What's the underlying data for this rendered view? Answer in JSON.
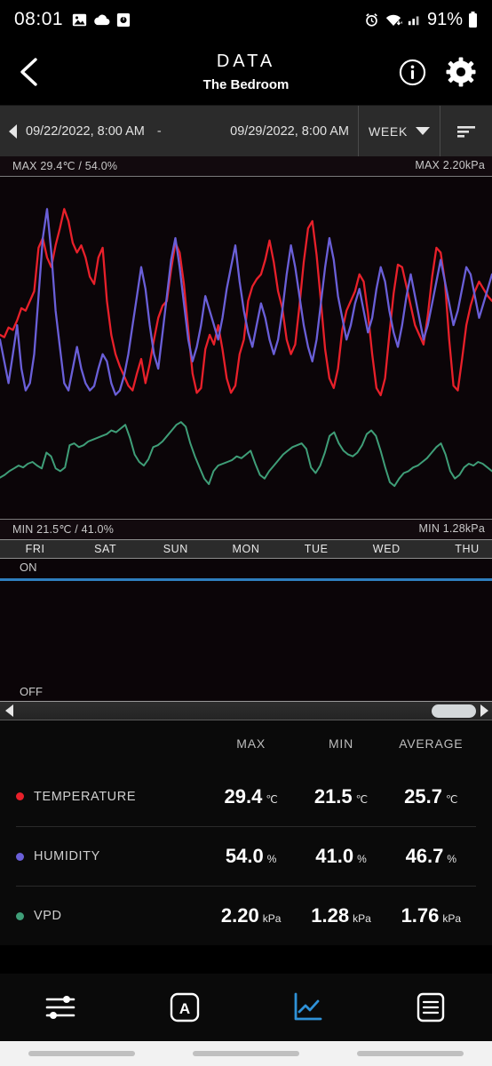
{
  "status_bar": {
    "time": "08:01",
    "left_icons": [
      "image-icon",
      "cloud-icon",
      "screenshot-icon"
    ],
    "right_icons": [
      "alarm-icon",
      "wifi-icon",
      "signal-icon"
    ],
    "battery": "91%"
  },
  "app_bar": {
    "back_icon": "chevron-left-icon",
    "title": "DATA",
    "subtitle": "The Bedroom",
    "info_icon": "info-icon",
    "settings_icon": "gear-icon"
  },
  "date_bar": {
    "prev_icon": "caret-left-icon",
    "start": "09/22/2022, 8:00 AM",
    "separator": "-",
    "end": "09/29/2022, 8:00 AM",
    "range_label": "WEEK",
    "range_caret_icon": "chevron-down-icon",
    "filter_icon": "filter-list-icon"
  },
  "chart_data": {
    "type": "line",
    "title": "",
    "max_left_label": "MAX 29.4℃ / 54.0%",
    "max_right_label": "MAX 2.20kPa",
    "min_left_label": "MIN 21.5℃ / 41.0%",
    "min_right_label": "MIN 1.28kPa",
    "xlabel": "",
    "ylabel": "",
    "grid": false,
    "legend_position": "bottom-table",
    "categories": [
      "FRI",
      "SAT",
      "SUN",
      "MON",
      "TUE",
      "WED",
      "THU"
    ],
    "axis_left": {
      "name": "Temperature / Humidity",
      "min": 21.5,
      "max": 29.4,
      "units": "℃ / %"
    },
    "axis_right": {
      "name": "VPD",
      "min": 1.28,
      "max": 2.2,
      "units": "kPa"
    },
    "series": [
      {
        "name": "TEMPERATURE",
        "color": "#e8202a",
        "unit": "℃",
        "values": [
          24.2,
          24.1,
          24.5,
          24.4,
          24.8,
          25.3,
          25.2,
          25.6,
          26.0,
          27.8,
          28.2,
          27.4,
          27.0,
          27.9,
          28.6,
          29.4,
          28.9,
          28.0,
          27.6,
          27.9,
          27.4,
          26.6,
          26.3,
          27.4,
          27.8,
          25.6,
          24.2,
          23.4,
          22.9,
          22.5,
          22.1,
          21.9,
          22.6,
          23.2,
          22.2,
          23.0,
          24.0,
          24.9,
          25.4,
          25.6,
          26.9,
          28.0,
          27.6,
          26.3,
          24.4,
          22.6,
          21.8,
          22.0,
          23.6,
          24.2,
          23.8,
          24.6,
          23.6,
          22.4,
          21.8,
          22.1,
          23.4,
          24.0,
          25.6,
          26.2,
          26.5,
          26.7,
          27.3,
          28.1,
          27.2,
          26.0,
          25.3,
          24.0,
          23.4,
          23.8,
          25.4,
          27.2,
          28.6,
          28.9,
          27.5,
          25.6,
          23.6,
          22.4,
          22.0,
          22.8,
          24.4,
          25.2,
          25.6,
          26.0,
          26.7,
          26.4,
          25.1,
          23.4,
          22.0,
          21.7,
          22.4,
          24.2,
          25.9,
          27.1,
          27.0,
          26.2,
          25.4,
          24.6,
          24.2,
          23.8,
          25.0,
          26.6,
          27.8,
          27.6,
          26.4,
          24.0,
          22.1,
          21.9,
          23.2,
          24.6,
          25.4,
          26.0,
          26.4,
          26.1,
          25.8,
          25.6
        ]
      },
      {
        "name": "HUMIDITY",
        "color": "#6a5fd8",
        "unit": "%",
        "values": [
          45.0,
          43.5,
          42.0,
          44.0,
          46.0,
          43.0,
          41.5,
          42.0,
          44.0,
          48.0,
          52.0,
          54.0,
          51.0,
          47.0,
          44.5,
          42.0,
          41.5,
          43.0,
          44.5,
          43.0,
          42.0,
          41.5,
          41.8,
          43.0,
          44.0,
          43.5,
          42.0,
          41.2,
          41.5,
          42.5,
          44.0,
          46.0,
          48.0,
          50.0,
          48.5,
          46.0,
          44.0,
          43.0,
          45.5,
          48.0,
          50.5,
          52.0,
          50.0,
          47.5,
          45.0,
          43.5,
          44.5,
          46.0,
          48.0,
          47.0,
          46.0,
          45.0,
          46.5,
          48.5,
          50.0,
          51.5,
          49.0,
          47.0,
          45.5,
          44.5,
          46.0,
          47.5,
          46.5,
          45.0,
          44.0,
          45.0,
          47.0,
          49.5,
          51.5,
          50.0,
          48.0,
          46.0,
          44.5,
          43.5,
          45.0,
          47.5,
          50.0,
          52.0,
          50.5,
          48.0,
          46.5,
          45.0,
          46.0,
          47.5,
          48.5,
          47.0,
          45.5,
          46.5,
          48.5,
          50.0,
          49.0,
          47.0,
          45.5,
          44.5,
          46.0,
          48.0,
          49.5,
          48.0,
          46.5,
          45.0,
          46.0,
          47.5,
          49.0,
          50.5,
          49.0,
          47.5,
          46.0,
          47.0,
          48.5,
          50.0,
          49.5,
          48.0,
          46.5,
          47.5,
          48.5,
          49.5
        ]
      },
      {
        "name": "VPD",
        "color": "#3f9e78",
        "unit": "kPa",
        "values": [
          1.45,
          1.48,
          1.52,
          1.55,
          1.58,
          1.56,
          1.6,
          1.62,
          1.58,
          1.55,
          1.72,
          1.68,
          1.55,
          1.52,
          1.56,
          1.8,
          1.82,
          1.78,
          1.8,
          1.84,
          1.86,
          1.88,
          1.9,
          1.92,
          1.96,
          1.94,
          1.98,
          2.02,
          1.88,
          1.7,
          1.62,
          1.58,
          1.65,
          1.78,
          1.8,
          1.84,
          1.9,
          1.96,
          2.02,
          2.05,
          2.0,
          1.82,
          1.68,
          1.56,
          1.44,
          1.38,
          1.52,
          1.58,
          1.6,
          1.62,
          1.64,
          1.68,
          1.66,
          1.7,
          1.74,
          1.6,
          1.48,
          1.44,
          1.52,
          1.58,
          1.64,
          1.7,
          1.74,
          1.78,
          1.8,
          1.82,
          1.76,
          1.56,
          1.5,
          1.58,
          1.72,
          1.9,
          1.94,
          1.82,
          1.74,
          1.7,
          1.68,
          1.72,
          1.8,
          1.92,
          1.96,
          1.9,
          1.74,
          1.56,
          1.4,
          1.36,
          1.44,
          1.5,
          1.52,
          1.56,
          1.58,
          1.62,
          1.66,
          1.72,
          1.78,
          1.82,
          1.7,
          1.52,
          1.44,
          1.48,
          1.56,
          1.6,
          1.58,
          1.62,
          1.6,
          1.56,
          1.52
        ]
      }
    ]
  },
  "onoff_zone": {
    "on_label": "ON",
    "off_label": "OFF",
    "on_color": "#2f7fbf"
  },
  "scrollbar": {
    "left_arrow_icon": "caret-left-icon",
    "right_arrow_icon": "caret-right-icon",
    "thumb_name": "scroll-thumb"
  },
  "stats": {
    "columns": [
      "MAX",
      "MIN",
      "AVERAGE"
    ],
    "rows": [
      {
        "label": "TEMPERATURE",
        "color": "#e8202a",
        "max": "29.4",
        "min": "21.5",
        "avg": "25.7",
        "unit": "℃"
      },
      {
        "label": "HUMIDITY",
        "color": "#6a5fd8",
        "max": "54.0",
        "min": "41.0",
        "avg": "46.7",
        "unit": "%"
      },
      {
        "label": "VPD",
        "color": "#3f9e78",
        "max": "2.20",
        "min": "1.28",
        "avg": "1.76",
        "unit": "kPa"
      }
    ]
  },
  "bottom_nav": {
    "items": [
      {
        "name": "controls-icon",
        "active": false
      },
      {
        "name": "auto-mode-icon",
        "active": false
      },
      {
        "name": "data-chart-icon",
        "active": true
      },
      {
        "name": "menu-list-icon",
        "active": false
      }
    ],
    "active_color": "#2f92d8"
  }
}
